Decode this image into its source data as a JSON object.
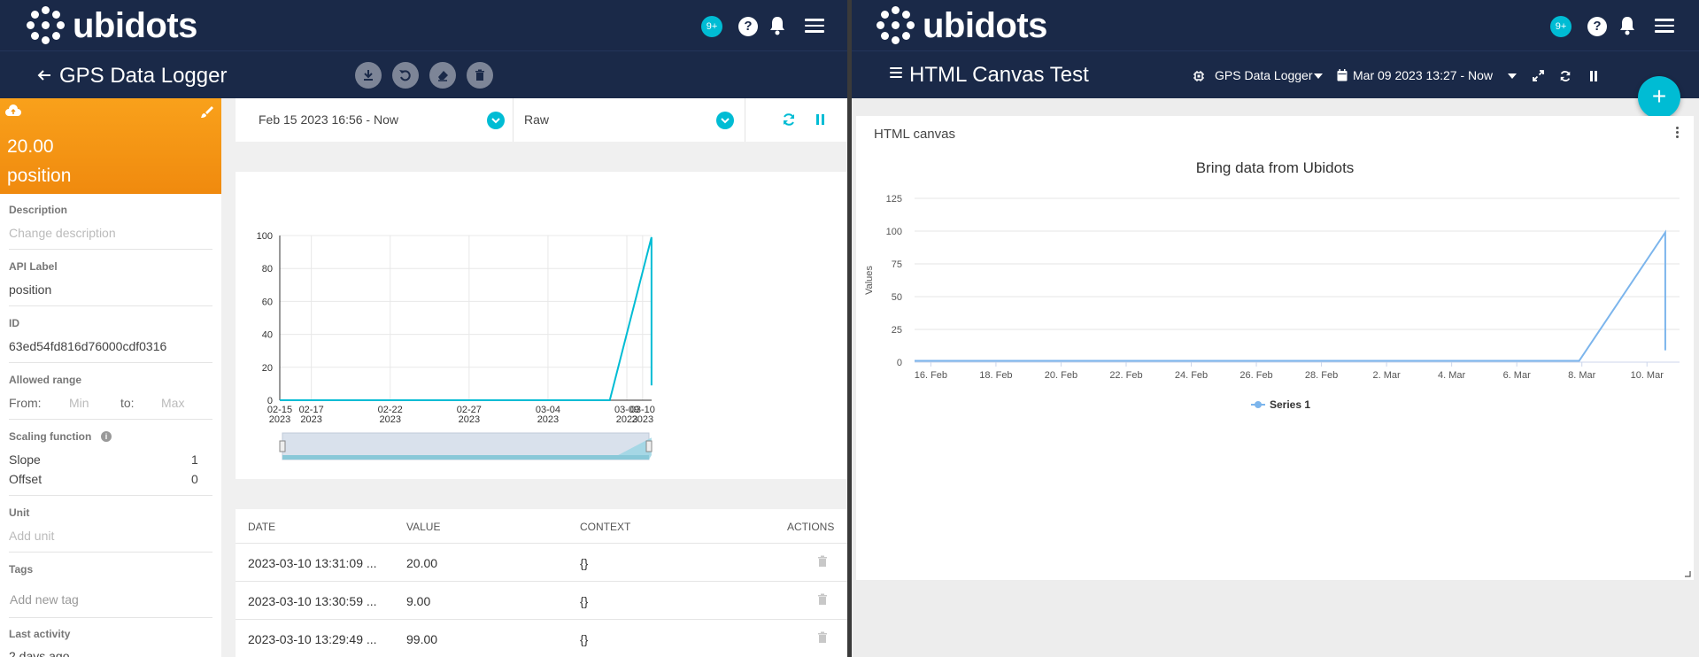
{
  "left": {
    "header": {
      "brand": "ubidots",
      "badge": "9+",
      "help": "?"
    },
    "device": {
      "title": "GPS Data Logger"
    },
    "variable": {
      "value": "20.00",
      "name": "position",
      "description_label": "Description",
      "description_placeholder": "Change description",
      "api_label_label": "API Label",
      "api_label_value": "position",
      "id_label": "ID",
      "id_value": "63ed54fd816d76000cdf0316",
      "allowed_range_label": "Allowed range",
      "from_label": "From:",
      "from_placeholder": "Min",
      "to_label": "to:",
      "to_placeholder": "Max",
      "scaling_label": "Scaling function",
      "slope_label": "Slope",
      "slope_value": "1",
      "offset_label": "Offset",
      "offset_value": "0",
      "unit_label": "Unit",
      "unit_placeholder": "Add unit",
      "tags_label": "Tags",
      "tags_placeholder": "Add new tag",
      "last_activity_label": "Last activity",
      "last_activity_value": "2 days ago"
    },
    "filters": {
      "date_range": "Feb 15 2023 16:56 - Now",
      "aggregation": "Raw"
    },
    "table": {
      "headers": [
        "DATE",
        "VALUE",
        "CONTEXT",
        "ACTIONS"
      ],
      "rows": [
        {
          "date": "2023-03-10 13:31:09 ...",
          "value": "20.00",
          "context": "{}"
        },
        {
          "date": "2023-03-10 13:30:59 ...",
          "value": "9.00",
          "context": "{}"
        },
        {
          "date": "2023-03-10 13:29:49 ...",
          "value": "99.00",
          "context": "{}"
        }
      ]
    }
  },
  "right": {
    "header": {
      "brand": "ubidots",
      "badge": "9+",
      "help": "?"
    },
    "dashboard": {
      "title": "HTML Canvas Test",
      "device_selector": "GPS Data Logger",
      "date_range": "Mar 09 2023 13:27 - Now"
    },
    "fab_label": "+",
    "widget": {
      "title": "HTML canvas"
    }
  },
  "chart_data": [
    {
      "type": "line",
      "title": "",
      "xlabel": "",
      "ylabel": "",
      "x_ticks": [
        "02-15 2023",
        "02-17 2023",
        "02-22 2023",
        "02-27 2023",
        "03-04 2023",
        "03-09 2023",
        "03-10 2023"
      ],
      "y_ticks": [
        0,
        20,
        40,
        60,
        80,
        100
      ],
      "ylim": [
        0,
        100
      ],
      "xlim": [
        "2023-02-15",
        "2023-03-10T13:40"
      ],
      "grid": true,
      "series": [
        {
          "x": [
            "2023-02-15",
            "2023-03-07T22:00",
            "2023-03-10T13:29",
            "2023-03-10T13:30",
            "2023-03-10T13:31"
          ],
          "y": [
            0,
            0,
            99,
            9,
            20
          ]
        }
      ],
      "color": "#00bcd4"
    },
    {
      "type": "line",
      "title": "Bring data from Ubidots",
      "xlabel": "",
      "ylabel": "Values",
      "x_ticks": [
        "16. Feb",
        "18. Feb",
        "20. Feb",
        "22. Feb",
        "24. Feb",
        "26. Feb",
        "28. Feb",
        "2. Mar",
        "4. Mar",
        "6. Mar",
        "8. Mar",
        "10. Mar"
      ],
      "y_ticks": [
        0,
        25,
        50,
        75,
        100,
        125
      ],
      "ylim": [
        0,
        125
      ],
      "xlim": [
        "2023-02-15T12:00",
        "2023-03-11"
      ],
      "grid": true,
      "legend": "bottom-center",
      "series": [
        {
          "name": "Series 1",
          "x": [
            "2023-02-15T12:00",
            "2023-03-07T22:00",
            "2023-03-10T13:29",
            "2023-03-10T13:31"
          ],
          "y": [
            1,
            1,
            99,
            9
          ]
        }
      ],
      "color": "#7cb5ec"
    }
  ]
}
